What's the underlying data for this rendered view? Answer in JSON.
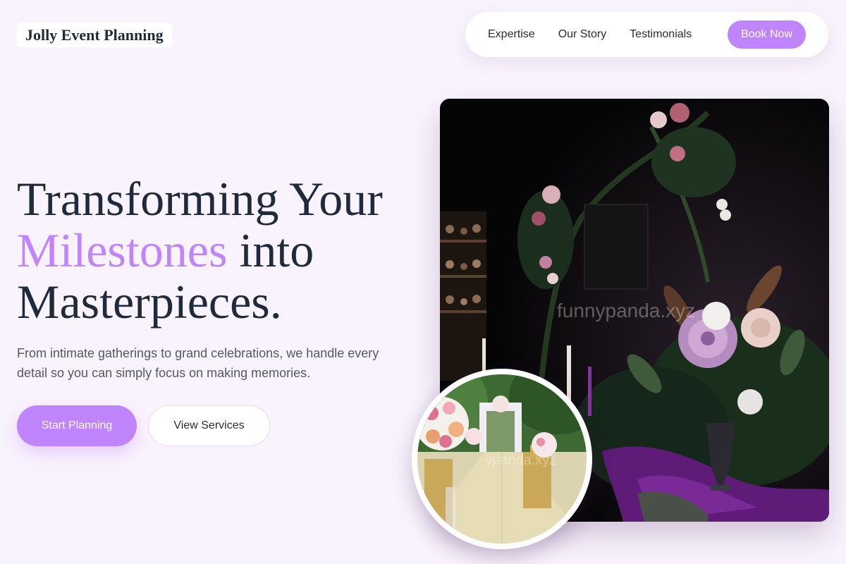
{
  "brand": {
    "name": "Jolly Event Planning"
  },
  "nav": {
    "links": [
      "Expertise",
      "Our Story",
      "Testimonials"
    ],
    "cta_label": "Book Now"
  },
  "hero": {
    "title_line1": "Transforming Your",
    "title_accent": "Milestones",
    "title_line2_rest": " into",
    "title_line3": "Masterpieces.",
    "subtitle": "From intimate gatherings to grand celebrations, we handle every detail so you can simply focus on making memories.",
    "primary_button": "Start Planning",
    "secondary_button": "View Services"
  },
  "images": {
    "watermark_main": "funnypanda.xyz",
    "watermark_inset": "ypanda.xyz"
  },
  "colors": {
    "accent": "#c084fc",
    "background": "#f9f3fd",
    "heading": "#1f2a3c"
  }
}
